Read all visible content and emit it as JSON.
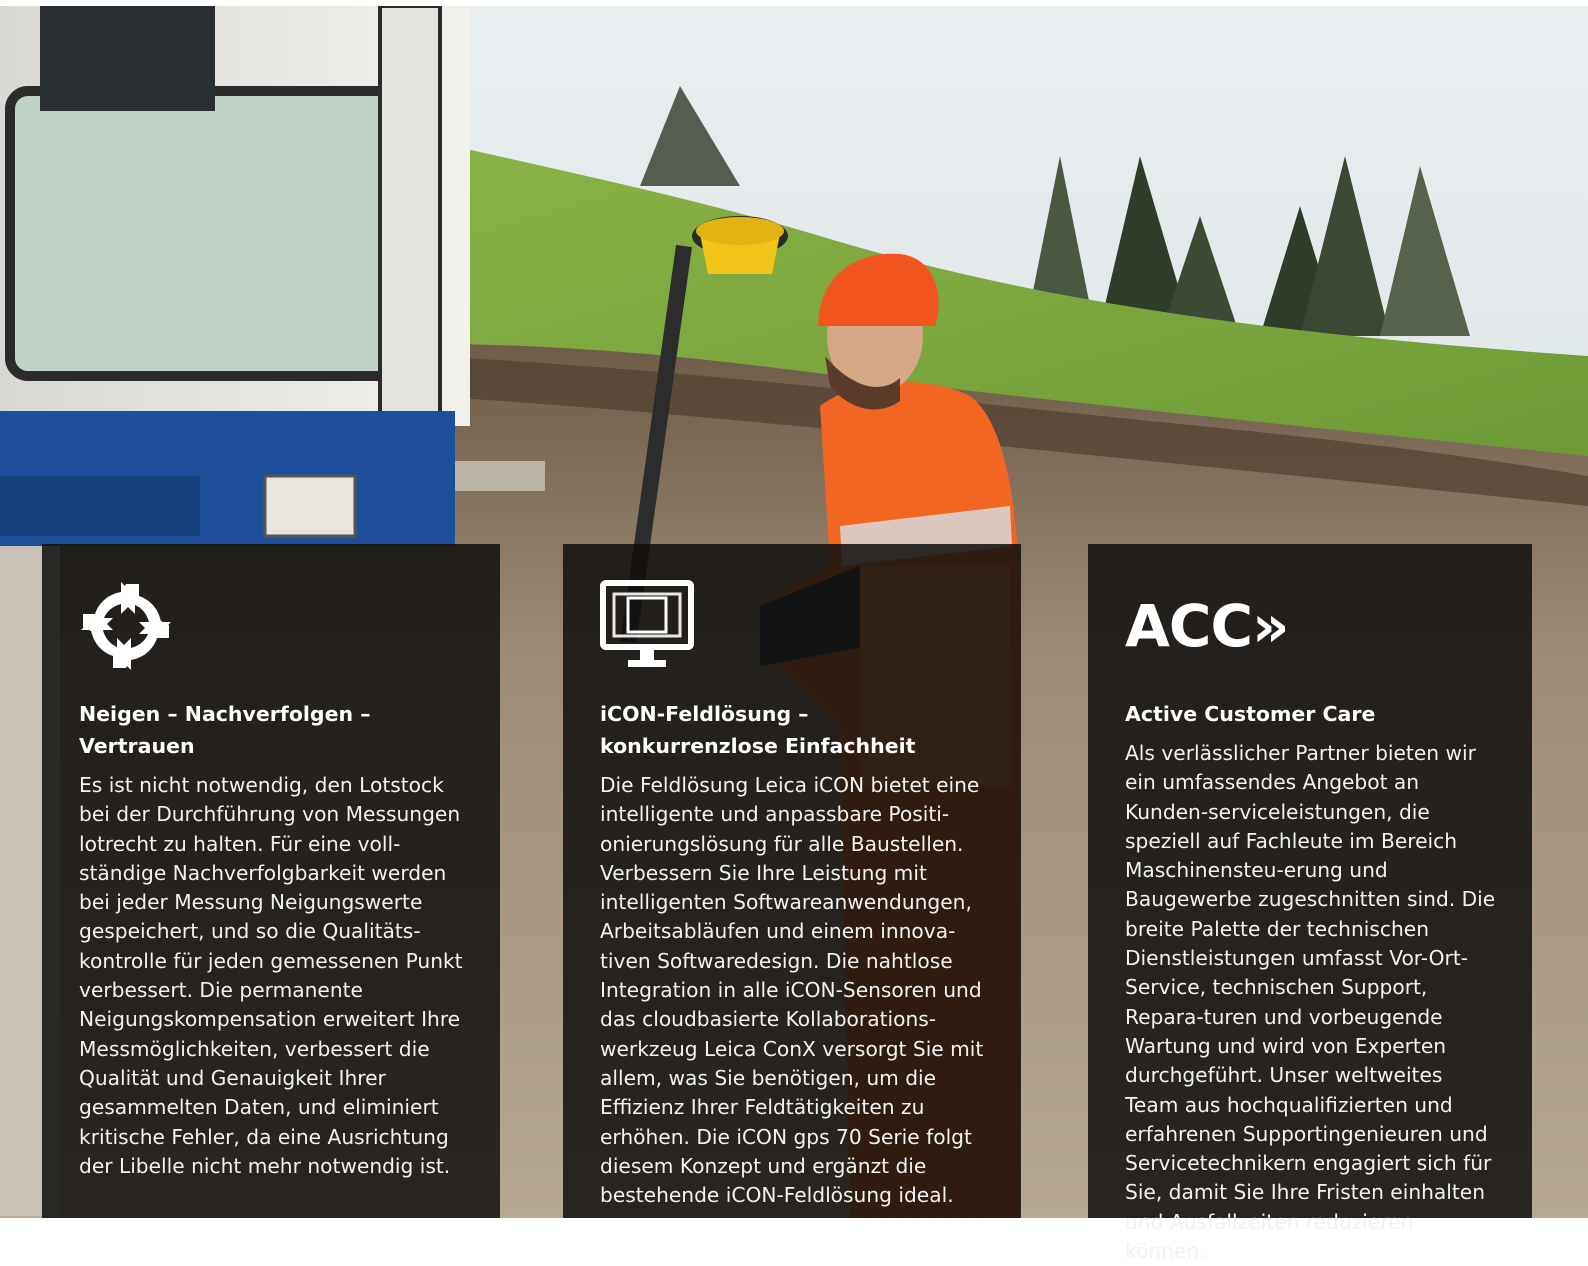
{
  "scene": {
    "description_icon": "construction-site-photo",
    "colors": {
      "sky": "#e7ecee",
      "grass": "#7fa83f",
      "soil": "#8a7a66",
      "vest": "#f26522",
      "excavator_blue": "#1f4e9c",
      "panel_bg": "#100f0e"
    }
  },
  "cards": [
    {
      "icon": "rotating-arrows-icon",
      "title": "Neigen – Nachverfolgen – Vertrauen",
      "body": "Es ist nicht notwendig, den Lotstock bei der Durchführung von Messungen lotrecht zu halten. Für eine voll-ständige Nachverfolgbarkeit werden bei jeder Messung Neigungswerte gespeichert, und so die Qualitäts-kontrolle für jeden gemessenen Punkt verbessert. Die permanente Neigungskompensation erweitert Ihre Messmöglichkeiten, verbessert die Qualität und Genauigkeit Ihrer gesammelten Daten, und eliminiert kritische Fehler, da eine Ausrichtung der Libelle nicht mehr notwendig ist."
    },
    {
      "icon": "monitor-icon",
      "title": "iCON-Feldlösung – konkurrenzlose Einfachheit",
      "body": "Die Feldlösung Leica iCON bietet eine intelligente und anpassbare Positi-onierungslösung für alle Baustellen. Verbessern Sie Ihre Leistung mit intelligenten Softwareanwendungen, Arbeitsabläufen und einem innova-tiven Softwaredesign. Die nahtlose Integration in alle iCON-Sensoren und das cloudbasierte Kollaborations-werkzeug Leica ConX versorgt Sie mit allem, was Sie benötigen, um die Effizienz Ihrer Feldtätigkeiten zu erhöhen. Die iCON gps 70 Serie folgt diesem Konzept und ergänzt die bestehende iCON-Feldlösung ideal."
    },
    {
      "icon": "acc-logo",
      "logo_text": "ACC»",
      "title": "Active Customer Care",
      "body": "Als verlässlicher Partner bieten wir ein umfassendes Angebot an Kunden-serviceleistungen, die speziell auf Fachleute im Bereich Maschinensteu-erung und Baugewerbe zugeschnitten sind. Die breite Palette der technischen Dienstleistungen umfasst Vor-Ort-Service, technischen Support, Repara-turen und vorbeugende Wartung und wird von Experten durchgeführt. Unser weltweites Team aus hochqualifizierten und erfahrenen Supportingenieuren und Servicetechnikern engagiert sich für Sie, damit Sie Ihre Fristen einhalten und Ausfallzeiten reduzieren können."
    }
  ]
}
